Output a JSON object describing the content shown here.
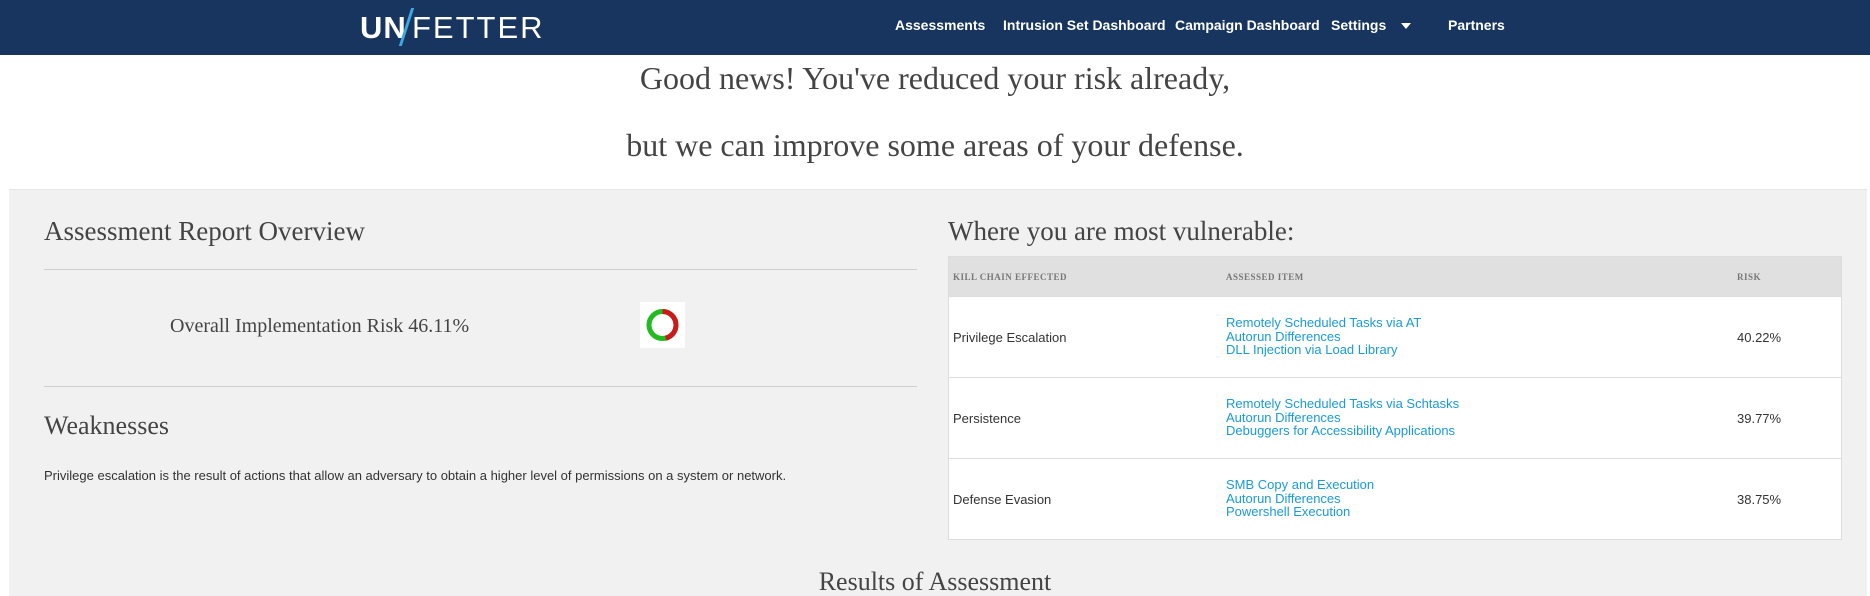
{
  "nav": {
    "logo_left": "UN",
    "logo_right": "FETTER",
    "items": [
      "Assessments",
      "Intrusion Set Dashboard",
      "Campaign Dashboard",
      "Settings",
      "Partners"
    ]
  },
  "hero": {
    "line1": "Good news! You've reduced your risk already,",
    "line2": "but we can improve some areas of your defense."
  },
  "overview": {
    "title": "Assessment Report Overview",
    "risk_label": "Overall Implementation Risk 46.11%",
    "risk_fraction": 0.4611,
    "risk_color": "#cc1a1a",
    "safe_color": "#22bb22"
  },
  "weaknesses": {
    "title": "Weaknesses",
    "text": "Privilege escalation is the result of actions that allow an adversary to obtain a higher level of permissions on a system or network."
  },
  "vulnerable": {
    "title": "Where you are most vulnerable:",
    "headers": [
      "KILL CHAIN EFFECTED",
      "ASSESSED ITEM",
      "RISK"
    ],
    "rows": [
      {
        "phase": "Privilege Escalation",
        "items": [
          "Remotely Scheduled Tasks via AT",
          "Autorun Differences",
          "DLL Injection via Load Library"
        ],
        "risk": "40.22%"
      },
      {
        "phase": "Persistence",
        "items": [
          "Remotely Scheduled Tasks via Schtasks",
          "Autorun Differences",
          "Debuggers for Accessibility Applications"
        ],
        "risk": "39.77%"
      },
      {
        "phase": "Defense Evasion",
        "items": [
          "SMB Copy and Execution",
          "Autorun Differences",
          "Powershell Execution"
        ],
        "risk": "38.75%"
      }
    ]
  },
  "results": {
    "title": "Results of Assessment"
  },
  "colors": {
    "navbar": "#17355e",
    "link": "#1a9ad6",
    "logo_accent": "#3ea8e0"
  }
}
